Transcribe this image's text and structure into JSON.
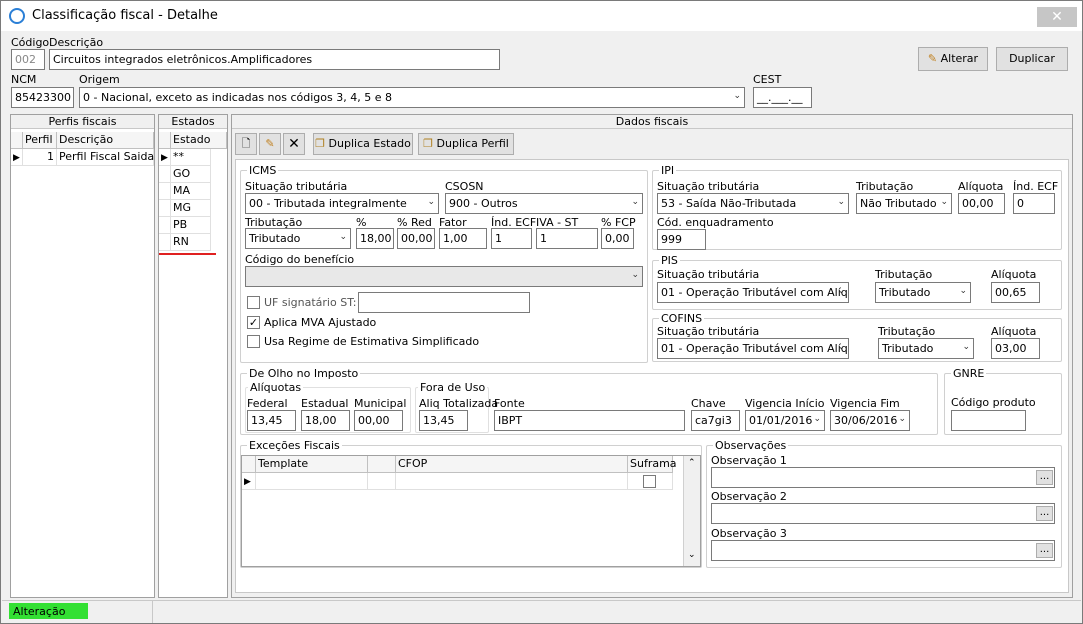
{
  "window": {
    "title": "Classificação fiscal - Detalhe",
    "close": "✕"
  },
  "header": {
    "codigo_label": "Código",
    "codigo_value": "002",
    "descricao_label": "Descrição",
    "descricao_value": "Circuitos integrados eletrônicos.Amplificadores",
    "ncm_label": "NCM",
    "ncm_value": "85423300",
    "origem_label": "Origem",
    "origem_value": "0 - Nacional, exceto as indicadas nos códigos 3, 4, 5 e 8",
    "cest_label": "CEST",
    "cest_value": "__.___.__",
    "alterar": "Alterar",
    "duplicar": "Duplicar"
  },
  "perfis": {
    "title": "Perfis fiscais",
    "col_perfil": "Perfil",
    "col_descricao": "Descrição",
    "rows": [
      {
        "perfil": "1",
        "descricao": "Perfil Fiscal Saida"
      }
    ]
  },
  "estados": {
    "title": "Estados",
    "col": "Estado",
    "rows": [
      "**",
      "GO",
      "MA",
      "MG",
      "PB",
      "RN"
    ]
  },
  "dados": {
    "title": "Dados fiscais",
    "duplica_estado": "Duplica Estado",
    "duplica_perfil": "Duplica Perfil",
    "icms": {
      "title": "ICMS",
      "sit_label": "Situação tributária",
      "sit_value": "00 - Tributada integralmente",
      "csosn_label": "CSOSN",
      "csosn_value": "900 - Outros",
      "trib_label": "Tributação",
      "trib_value": "Tributado",
      "pct_label": "%",
      "pct_value": "18,00",
      "pctred_label": "% Red",
      "pctred_value": "00,00",
      "fator_label": "Fator",
      "fator_value": "1,00",
      "indecf_label": "Índ. ECF",
      "indecf_value": "1",
      "ivast_label": "IVA - ST",
      "ivast_value": "1",
      "fcp_label": "% FCP",
      "fcp_value": "0,00",
      "beneficio_label": "Código do benefício",
      "beneficio_value": "",
      "uf_sig_label": "UF signatário ST:",
      "mva_label": "Aplica MVA Ajustado",
      "regime_label": "Usa Regime de Estimativa Simplificado"
    },
    "ipi": {
      "title": "IPI",
      "sit_label": "Situação tributária",
      "sit_value": "53 - Saída Não-Tributada",
      "trib_label": "Tributação",
      "trib_value": "Não Tributado",
      "aliq_label": "Alíquota",
      "aliq_value": "00,00",
      "indecf_label": "Índ. ECF",
      "indecf_value": "0",
      "enq_label": "Cód. enquadramento",
      "enq_value": "999"
    },
    "pis": {
      "title": "PIS",
      "sit_label": "Situação tributária",
      "sit_value": "01 - Operação Tributável com Alíqu",
      "trib_label": "Tributação",
      "trib_value": "Tributado",
      "aliq_label": "Alíquota",
      "aliq_value": "00,65"
    },
    "cofins": {
      "title": "COFINS",
      "sit_label": "Situação tributária",
      "sit_value": "01 - Operação Tributável com Alíqu",
      "trib_label": "Tributação",
      "trib_value": "Tributado",
      "aliq_label": "Alíquota",
      "aliq_value": "03,00"
    },
    "olho": {
      "title": "De Olho no Imposto",
      "aliquotas_title": "Alíquotas",
      "federal_label": "Federal",
      "federal_value": "13,45",
      "estadual_label": "Estadual",
      "estadual_value": "18,00",
      "municipal_label": "Municipal",
      "municipal_value": "00,00",
      "fora_title": "Fora de Uso",
      "aliq_tot_label": "Aliq Totalizada",
      "aliq_tot_value": "13,45",
      "fonte_label": "Fonte",
      "fonte_value": "IBPT",
      "chave_label": "Chave",
      "chave_value": "ca7gi3",
      "vig_ini_label": "Vigencia Início",
      "vig_ini_value": "01/01/2016",
      "vig_fim_label": "Vigencia Fim",
      "vig_fim_value": "30/06/2016"
    },
    "gnre": {
      "title": "GNRE",
      "cod_label": "Código produto",
      "cod_value": ""
    },
    "excecoes": {
      "title": "Exceções Fiscais",
      "col_template": "Template",
      "col_cfop": "CFOP",
      "col_suframa": "Suframa"
    },
    "obs": {
      "title": "Observações",
      "obs1_label": "Observação 1",
      "obs2_label": "Observação 2",
      "obs3_label": "Observação 3",
      "dots": "..."
    }
  },
  "status": {
    "mode": "Alteração"
  }
}
